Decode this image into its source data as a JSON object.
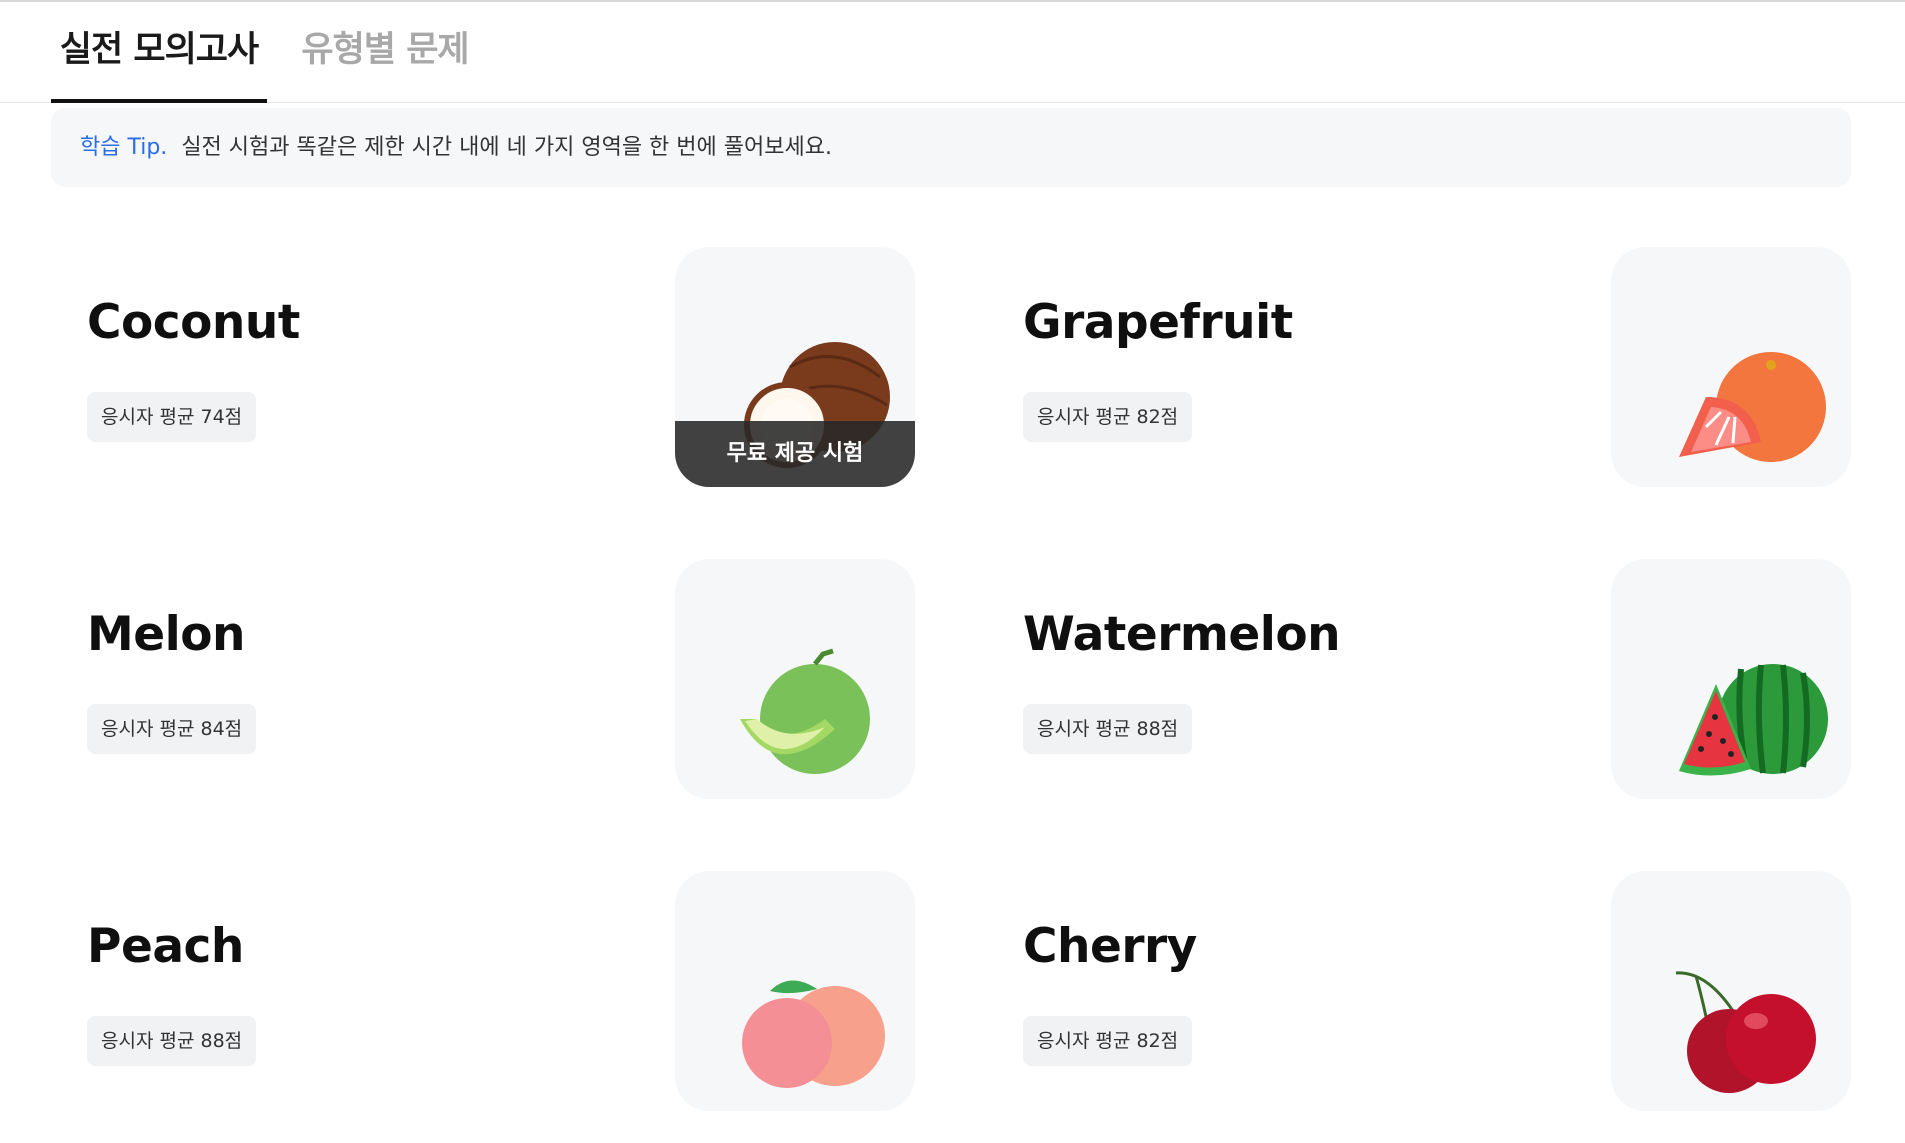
{
  "tabs": [
    {
      "label": "실전 모의고사",
      "active": true
    },
    {
      "label": "유형별 문제",
      "active": false
    }
  ],
  "tip": {
    "label": "학습 Tip.",
    "text": "실전 시험과 똑같은 제한 시간 내에 네 가지 영역을 한 번에 풀어보세요."
  },
  "exams": [
    {
      "title": "Coconut",
      "badge": "응시자 평균 74점",
      "icon": "coconut-icon",
      "banner": "무료 제공 시험"
    },
    {
      "title": "Grapefruit",
      "badge": "응시자 평균 82점",
      "icon": "grapefruit-icon"
    },
    {
      "title": "Melon",
      "badge": "응시자 평균 84점",
      "icon": "melon-icon"
    },
    {
      "title": "Watermelon",
      "badge": "응시자 평균 88점",
      "icon": "watermelon-icon"
    },
    {
      "title": "Peach",
      "badge": "응시자 평균 88점",
      "icon": "peach-icon"
    },
    {
      "title": "Cherry",
      "badge": "응시자 평균 82점",
      "icon": "cherry-icon"
    }
  ]
}
